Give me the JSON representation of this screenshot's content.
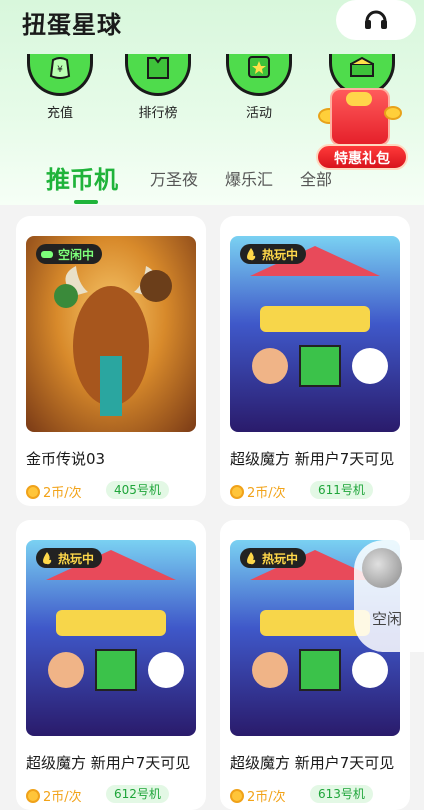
{
  "app": {
    "title": "扭蛋星球"
  },
  "categories": [
    {
      "label": "充值",
      "icon": "money-bag-icon"
    },
    {
      "label": "排行榜",
      "icon": "trophy-shirt-icon"
    },
    {
      "label": "活动",
      "icon": "star-badge-icon"
    },
    {
      "label": "",
      "icon": "gift-icon"
    }
  ],
  "promo": {
    "label": "特惠礼包"
  },
  "tabs": [
    {
      "label": "推币机",
      "active": true
    },
    {
      "label": "万圣夜",
      "active": false
    },
    {
      "label": "爆乐汇",
      "active": false
    },
    {
      "label": "全部",
      "active": false
    }
  ],
  "cards": [
    {
      "status": "空闲中",
      "title": "金币传说03",
      "price": "2币/次",
      "machine": "405号机"
    },
    {
      "status": "热玩中",
      "title": "超级魔方 新用户7天可见",
      "price": "2币/次",
      "machine": "611号机"
    },
    {
      "status": "热玩中",
      "title": "超级魔方 新用户7天可见",
      "price": "2币/次",
      "machine": "612号机"
    },
    {
      "status": "热玩中",
      "title": "超级魔方 新用户7天可见",
      "price": "2币/次",
      "machine": "613号机"
    }
  ],
  "float_widget": {
    "label": "空闲"
  },
  "colors": {
    "accent": "#1fb33a",
    "price": "#f2a319",
    "promo": "#e5202a"
  }
}
